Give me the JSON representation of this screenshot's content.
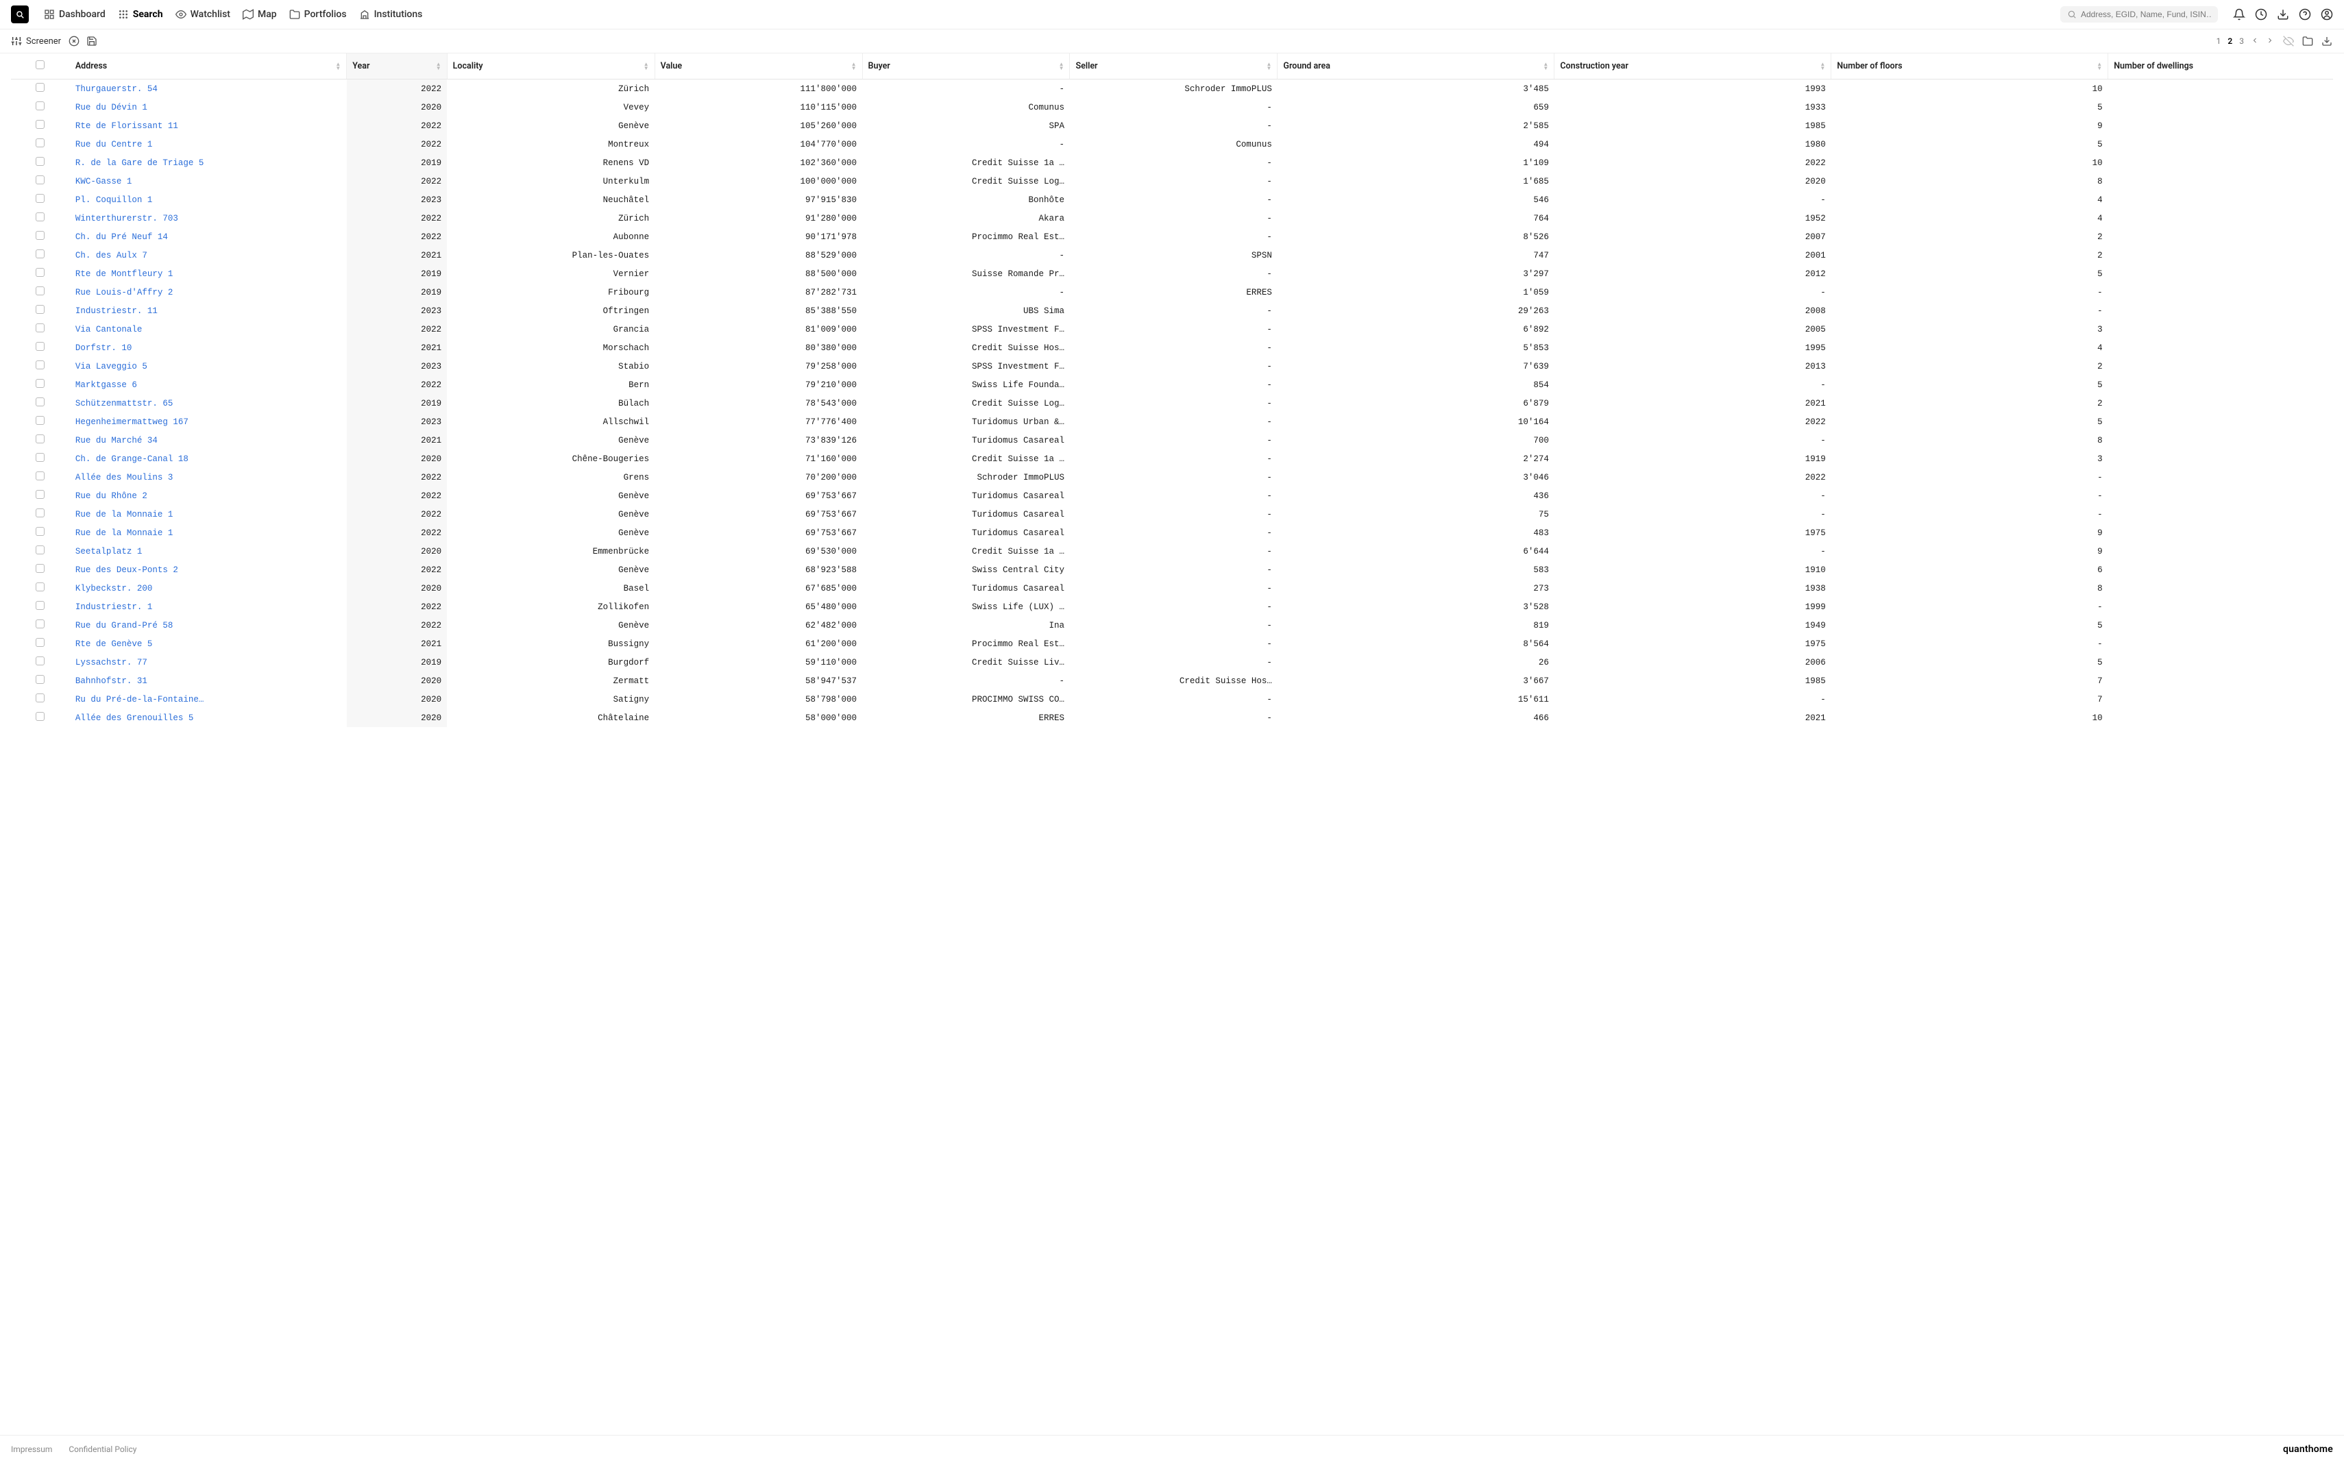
{
  "nav": {
    "dashboard": "Dashboard",
    "search": "Search",
    "watchlist": "Watchlist",
    "map": "Map",
    "portfolios": "Portfolios",
    "institutions": "Institutions"
  },
  "search_placeholder": "Address, EGID, Name, Fund, ISIN…",
  "subbar": {
    "screener": "Screener"
  },
  "pager": {
    "p1": "1",
    "p2": "2",
    "p3": "3"
  },
  "columns": {
    "address": "Address",
    "year": "Year",
    "locality": "Locality",
    "value": "Value",
    "buyer": "Buyer",
    "seller": "Seller",
    "ground_area": "Ground area",
    "construction_year": "Construction year",
    "floors": "Number of floors",
    "dwellings": "Number of dwellings"
  },
  "rows": [
    {
      "address": "Thurgauerstr. 54",
      "year": "2022",
      "locality": "Zürich",
      "value": "111'800'000",
      "buyer": "-",
      "seller": "Schroder ImmoPLUS",
      "ga": "3'485",
      "cy": "1993",
      "nf": "10",
      "nd": ""
    },
    {
      "address": "Rue du Dévin 1",
      "year": "2020",
      "locality": "Vevey",
      "value": "110'115'000",
      "buyer": "Comunus",
      "seller": "-",
      "ga": "659",
      "cy": "1933",
      "nf": "5",
      "nd": ""
    },
    {
      "address": "Rte de Florissant 11",
      "year": "2022",
      "locality": "Genève",
      "value": "105'260'000",
      "buyer": "SPA",
      "seller": "-",
      "ga": "2'585",
      "cy": "1985",
      "nf": "9",
      "nd": ""
    },
    {
      "address": "Rue du Centre 1",
      "year": "2022",
      "locality": "Montreux",
      "value": "104'770'000",
      "buyer": "-",
      "seller": "Comunus",
      "ga": "494",
      "cy": "1980",
      "nf": "5",
      "nd": ""
    },
    {
      "address": "R. de la Gare de Triage 5",
      "year": "2019",
      "locality": "Renens VD",
      "value": "102'360'000",
      "buyer": "Credit Suisse 1a …",
      "seller": "-",
      "ga": "1'109",
      "cy": "2022",
      "nf": "10",
      "nd": ""
    },
    {
      "address": "KWC-Gasse 1",
      "year": "2022",
      "locality": "Unterkulm",
      "value": "100'000'000",
      "buyer": "Credit Suisse Log…",
      "seller": "-",
      "ga": "1'685",
      "cy": "2020",
      "nf": "8",
      "nd": ""
    },
    {
      "address": "Pl. Coquillon 1",
      "year": "2023",
      "locality": "Neuchâtel",
      "value": "97'915'830",
      "buyer": "Bonhôte",
      "seller": "-",
      "ga": "546",
      "cy": "-",
      "nf": "4",
      "nd": ""
    },
    {
      "address": "Winterthurerstr. 703",
      "year": "2022",
      "locality": "Zürich",
      "value": "91'280'000",
      "buyer": "Akara",
      "seller": "-",
      "ga": "764",
      "cy": "1952",
      "nf": "4",
      "nd": ""
    },
    {
      "address": "Ch. du Pré Neuf 14",
      "year": "2022",
      "locality": "Aubonne",
      "value": "90'171'978",
      "buyer": "Procimmo Real Est…",
      "seller": "-",
      "ga": "8'526",
      "cy": "2007",
      "nf": "2",
      "nd": ""
    },
    {
      "address": "Ch. des Aulx 7",
      "year": "2021",
      "locality": "Plan-les-Ouates",
      "value": "88'529'000",
      "buyer": "-",
      "seller": "SPSN",
      "ga": "747",
      "cy": "2001",
      "nf": "2",
      "nd": ""
    },
    {
      "address": "Rte de Montfleury 1",
      "year": "2019",
      "locality": "Vernier",
      "value": "88'500'000",
      "buyer": "Suisse Romande Pr…",
      "seller": "-",
      "ga": "3'297",
      "cy": "2012",
      "nf": "5",
      "nd": ""
    },
    {
      "address": "Rue Louis-d'Affry 2",
      "year": "2019",
      "locality": "Fribourg",
      "value": "87'282'731",
      "buyer": "-",
      "seller": "ERRES",
      "ga": "1'059",
      "cy": "-",
      "nf": "-",
      "nd": ""
    },
    {
      "address": "Industriestr. 11",
      "year": "2023",
      "locality": "Oftringen",
      "value": "85'388'550",
      "buyer": "UBS Sima",
      "seller": "-",
      "ga": "29'263",
      "cy": "2008",
      "nf": "-",
      "nd": ""
    },
    {
      "address": "Via Cantonale",
      "year": "2022",
      "locality": "Grancia",
      "value": "81'009'000",
      "buyer": "SPSS Investment F…",
      "seller": "-",
      "ga": "6'892",
      "cy": "2005",
      "nf": "3",
      "nd": ""
    },
    {
      "address": "Dorfstr. 10",
      "year": "2021",
      "locality": "Morschach",
      "value": "80'380'000",
      "buyer": "Credit Suisse Hos…",
      "seller": "-",
      "ga": "5'853",
      "cy": "1995",
      "nf": "4",
      "nd": ""
    },
    {
      "address": "Via Laveggio 5",
      "year": "2023",
      "locality": "Stabio",
      "value": "79'258'000",
      "buyer": "SPSS Investment F…",
      "seller": "-",
      "ga": "7'639",
      "cy": "2013",
      "nf": "2",
      "nd": ""
    },
    {
      "address": "Marktgasse 6",
      "year": "2022",
      "locality": "Bern",
      "value": "79'210'000",
      "buyer": "Swiss Life Founda…",
      "seller": "-",
      "ga": "854",
      "cy": "-",
      "nf": "5",
      "nd": ""
    },
    {
      "address": "Schützenmattstr. 65",
      "year": "2019",
      "locality": "Bülach",
      "value": "78'543'000",
      "buyer": "Credit Suisse Log…",
      "seller": "-",
      "ga": "6'879",
      "cy": "2021",
      "nf": "2",
      "nd": ""
    },
    {
      "address": "Hegenheimermattweg 167",
      "year": "2023",
      "locality": "Allschwil",
      "value": "77'776'400",
      "buyer": "Turidomus Urban &…",
      "seller": "-",
      "ga": "10'164",
      "cy": "2022",
      "nf": "5",
      "nd": ""
    },
    {
      "address": "Rue du Marché 34",
      "year": "2021",
      "locality": "Genève",
      "value": "73'839'126",
      "buyer": "Turidomus Casareal",
      "seller": "-",
      "ga": "700",
      "cy": "-",
      "nf": "8",
      "nd": ""
    },
    {
      "address": "Ch. de Grange-Canal 18",
      "year": "2020",
      "locality": "Chêne-Bougeries",
      "value": "71'160'000",
      "buyer": "Credit Suisse 1a …",
      "seller": "-",
      "ga": "2'274",
      "cy": "1919",
      "nf": "3",
      "nd": ""
    },
    {
      "address": "Allée des Moulins 3",
      "year": "2022",
      "locality": "Grens",
      "value": "70'200'000",
      "buyer": "Schroder ImmoPLUS",
      "seller": "-",
      "ga": "3'046",
      "cy": "2022",
      "nf": "-",
      "nd": ""
    },
    {
      "address": "Rue du Rhône 2",
      "year": "2022",
      "locality": "Genève",
      "value": "69'753'667",
      "buyer": "Turidomus Casareal",
      "seller": "-",
      "ga": "436",
      "cy": "-",
      "nf": "-",
      "nd": ""
    },
    {
      "address": "Rue de la Monnaie 1",
      "year": "2022",
      "locality": "Genève",
      "value": "69'753'667",
      "buyer": "Turidomus Casareal",
      "seller": "-",
      "ga": "75",
      "cy": "-",
      "nf": "-",
      "nd": ""
    },
    {
      "address": "Rue de la Monnaie 1",
      "year": "2022",
      "locality": "Genève",
      "value": "69'753'667",
      "buyer": "Turidomus Casareal",
      "seller": "-",
      "ga": "483",
      "cy": "1975",
      "nf": "9",
      "nd": ""
    },
    {
      "address": "Seetalplatz 1",
      "year": "2020",
      "locality": "Emmenbrücke",
      "value": "69'530'000",
      "buyer": "Credit Suisse 1a …",
      "seller": "-",
      "ga": "6'644",
      "cy": "-",
      "nf": "9",
      "nd": ""
    },
    {
      "address": "Rue des Deux-Ponts 2",
      "year": "2022",
      "locality": "Genève",
      "value": "68'923'588",
      "buyer": "Swiss Central City",
      "seller": "-",
      "ga": "583",
      "cy": "1910",
      "nf": "6",
      "nd": ""
    },
    {
      "address": "Klybeckstr. 200",
      "year": "2020",
      "locality": "Basel",
      "value": "67'685'000",
      "buyer": "Turidomus Casareal",
      "seller": "-",
      "ga": "273",
      "cy": "1938",
      "nf": "8",
      "nd": ""
    },
    {
      "address": "Industriestr. 1",
      "year": "2022",
      "locality": "Zollikofen",
      "value": "65'480'000",
      "buyer": "Swiss Life (LUX) …",
      "seller": "-",
      "ga": "3'528",
      "cy": "1999",
      "nf": "-",
      "nd": ""
    },
    {
      "address": "Rue du Grand-Pré 58",
      "year": "2022",
      "locality": "Genève",
      "value": "62'482'000",
      "buyer": "Ina",
      "seller": "-",
      "ga": "819",
      "cy": "1949",
      "nf": "5",
      "nd": ""
    },
    {
      "address": "Rte de Genève 5",
      "year": "2021",
      "locality": "Bussigny",
      "value": "61'200'000",
      "buyer": "Procimmo Real Est…",
      "seller": "-",
      "ga": "8'564",
      "cy": "1975",
      "nf": "-",
      "nd": ""
    },
    {
      "address": "Lyssachstr. 77",
      "year": "2019",
      "locality": "Burgdorf",
      "value": "59'110'000",
      "buyer": "Credit Suisse Liv…",
      "seller": "-",
      "ga": "26",
      "cy": "2006",
      "nf": "5",
      "nd": ""
    },
    {
      "address": "Bahnhofstr. 31",
      "year": "2020",
      "locality": "Zermatt",
      "value": "58'947'537",
      "buyer": "-",
      "seller": "Credit Suisse Hos…",
      "ga": "3'667",
      "cy": "1985",
      "nf": "7",
      "nd": ""
    },
    {
      "address": "Ru du Pré-de-la-Fontaine…",
      "year": "2020",
      "locality": "Satigny",
      "value": "58'798'000",
      "buyer": "PROCIMMO SWISS CO…",
      "seller": "-",
      "ga": "15'611",
      "cy": "-",
      "nf": "7",
      "nd": ""
    },
    {
      "address": "Allée des Grenouilles 5",
      "year": "2020",
      "locality": "Châtelaine",
      "value": "58'000'000",
      "buyer": "ERRES",
      "seller": "-",
      "ga": "466",
      "cy": "2021",
      "nf": "10",
      "nd": ""
    }
  ],
  "footer": {
    "impressum": "Impressum",
    "policy": "Confidential Policy",
    "brand": "quanthome"
  }
}
